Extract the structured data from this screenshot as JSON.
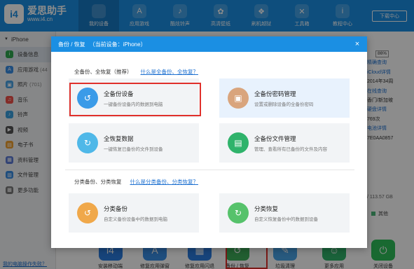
{
  "app": {
    "logo_text": "爱思助手",
    "logo_url": "www.i4.cn",
    "logo_mark": "i4"
  },
  "nav": [
    {
      "label": "我的设备",
      "icon": "apple-icon",
      "glyph": "",
      "active": true
    },
    {
      "label": "应用游戏",
      "icon": "app-store-icon",
      "glyph": "A",
      "active": false
    },
    {
      "label": "酷炫铃声",
      "icon": "bell-icon",
      "glyph": "♪",
      "active": false
    },
    {
      "label": "高清壁纸",
      "icon": "flower-icon",
      "glyph": "✿",
      "active": false
    },
    {
      "label": "刷机越狱",
      "icon": "dropbox-icon",
      "glyph": "❖",
      "active": false
    },
    {
      "label": "工具箱",
      "icon": "tools-icon",
      "glyph": "✕",
      "active": false
    },
    {
      "label": "教程中心",
      "icon": "info-icon",
      "glyph": "i",
      "active": false
    }
  ],
  "download_center": "下载中心",
  "sidebar": {
    "device": "iPhone",
    "items": [
      {
        "label": "设备信息",
        "count": "",
        "color": "#2fa84f",
        "glyph": "i",
        "active": true
      },
      {
        "label": "应用游戏",
        "count": "(44",
        "color": "#3a8ee6",
        "glyph": "A",
        "active": false
      },
      {
        "label": "照片",
        "count": "(701)",
        "color": "#4aa5e8",
        "glyph": "▣",
        "active": false
      },
      {
        "label": "音乐",
        "count": "",
        "color": "#f0504a",
        "glyph": "♫",
        "active": false
      },
      {
        "label": "铃声",
        "count": "",
        "color": "#3aa0e0",
        "glyph": "♪",
        "active": false
      },
      {
        "label": "视频",
        "count": "",
        "color": "#555555",
        "glyph": "▶",
        "active": false
      },
      {
        "label": "电子书",
        "count": "",
        "color": "#f0a030",
        "glyph": "▤",
        "active": false
      },
      {
        "label": "资料管理",
        "count": "",
        "color": "#5b7bd5",
        "glyph": "▦",
        "active": false
      },
      {
        "label": "文件管理",
        "count": "",
        "color": "#3a8ee6",
        "glyph": "▥",
        "active": false
      },
      {
        "label": "更多功能",
        "count": "",
        "color": "#7a7a7a",
        "glyph": "▩",
        "active": false
      }
    ],
    "bottom_link": "我的电脑操作失败？"
  },
  "info": {
    "percent": "86%",
    "lines": [
      {
        "text": "精确查询",
        "link": true
      },
      {
        "text": "iCloud详情",
        "link": true
      },
      {
        "text": "2014年34周",
        "link": false
      },
      {
        "text": "在线查询",
        "link": true
      },
      {
        "text": "香门/新加坡",
        "link": false
      },
      {
        "text": "硬盘详情",
        "link": true
      },
      {
        "text": "769次",
        "link": false
      },
      {
        "text": "电池详情",
        "link": true
      },
      {
        "text": "7E0AA0857",
        "link": false
      }
    ],
    "storage": "/ 113.57 GB",
    "legend_other": "其他"
  },
  "toolbar": {
    "items": [
      {
        "label": "安装移动端",
        "color": "#2a7de1",
        "glyph": "i4"
      },
      {
        "label": "修复应用弹窗",
        "color": "#3a8ee6",
        "glyph": "A"
      },
      {
        "label": "修复应用闪退",
        "color": "#2a7de1",
        "glyph": "▦"
      },
      {
        "label": "备份 / 恢复",
        "color": "#3fae5a",
        "glyph": "↺"
      },
      {
        "label": "垃圾清理",
        "color": "#4aa5e8",
        "glyph": "✎"
      },
      {
        "label": "更多应用",
        "color": "#30b36b",
        "glyph": "☺"
      },
      {
        "label": "关闭设备",
        "color": "#2fbf5a",
        "glyph": "⏻"
      }
    ]
  },
  "modal": {
    "title": "备份 / 恢复",
    "subtitle": "（当前设备：iPhone）",
    "close": "×",
    "section1": {
      "title": "全备份、全恢复（推荐）",
      "link": "什么是全备份、全恢复？"
    },
    "section2": {
      "title": "分类备份、分类恢复",
      "link": "什么是分类备份、分类恢复？"
    },
    "cards": [
      {
        "title": "全备份设备",
        "desc": "一键备份设备内的数据到电脑",
        "color": "#3a9be8",
        "glyph": "↺",
        "selected": false
      },
      {
        "title": "全备份密码管理",
        "desc": "设置或删除设备的全备份密码",
        "color": "#d9a57d",
        "glyph": "▣",
        "selected": true
      },
      {
        "title": "全恢复数据",
        "desc": "一键恢复已备份的文件到设备",
        "color": "#4fb8e8",
        "glyph": "↻",
        "selected": false
      },
      {
        "title": "全备份文件管理",
        "desc": "管理、查看所有已备份的文件及内容",
        "color": "#2fb36b",
        "glyph": "▤",
        "selected": false
      },
      {
        "title": "分类备份",
        "desc": "自定义备份设备中的数据到电脑",
        "color": "#f0a84a",
        "glyph": "↺",
        "selected": false
      },
      {
        "title": "分类恢复",
        "desc": "自定义恢复备份中的数据到设备",
        "color": "#56c26b",
        "glyph": "↻",
        "selected": false
      }
    ]
  }
}
